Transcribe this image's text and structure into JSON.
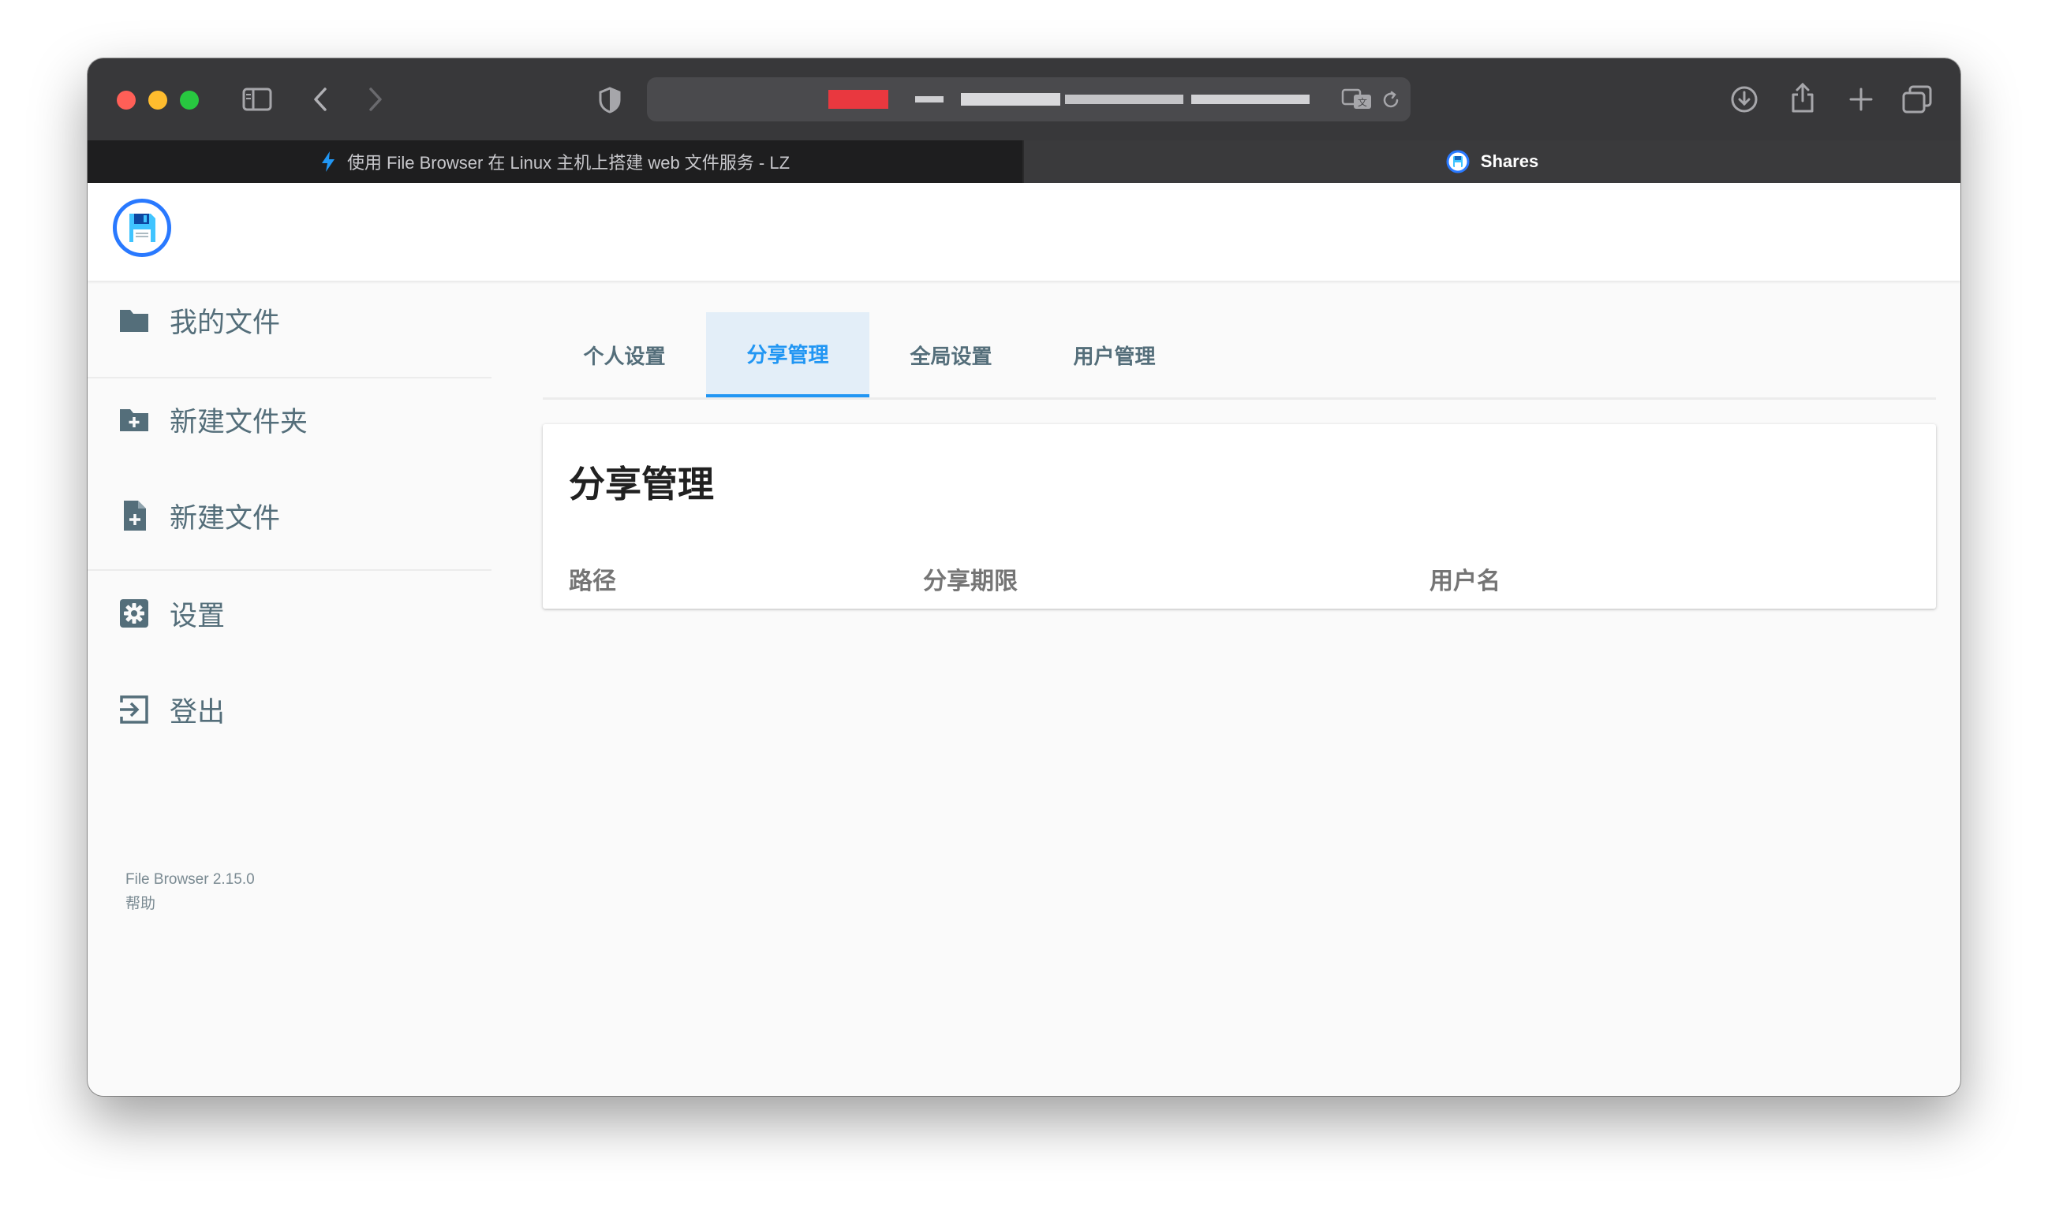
{
  "browser": {
    "tabs": [
      {
        "label": "使用 File Browser 在 Linux 主机上搭建 web 文件服务 - LZ",
        "active": false
      },
      {
        "label": "Shares",
        "active": true
      }
    ],
    "icons": [
      "sidebar-toggle-icon",
      "back-icon",
      "forward-icon",
      "shield-icon",
      "translate-icon",
      "reload-icon",
      "download-icon",
      "share-icon",
      "new-tab-icon",
      "tab-overview-icon"
    ]
  },
  "sidebar": {
    "items": [
      {
        "label": "我的文件",
        "icon": "folder-icon"
      },
      {
        "label": "新建文件夹",
        "icon": "new-folder-icon"
      },
      {
        "label": "新建文件",
        "icon": "new-file-icon"
      },
      {
        "label": "设置",
        "icon": "settings-icon"
      },
      {
        "label": "登出",
        "icon": "logout-icon"
      }
    ],
    "version": "File Browser 2.15.0",
    "help": "帮助"
  },
  "settings_tabs": [
    {
      "label": "个人设置",
      "active": false
    },
    {
      "label": "分享管理",
      "active": true
    },
    {
      "label": "全局设置",
      "active": false
    },
    {
      "label": "用户管理",
      "active": false
    }
  ],
  "shares": {
    "title": "分享管理",
    "columns": [
      "路径",
      "分享期限",
      "用户名"
    ]
  },
  "colors": {
    "accent": "#2196f3",
    "nav_text": "#546e7a",
    "toolbar": "#38383a"
  }
}
